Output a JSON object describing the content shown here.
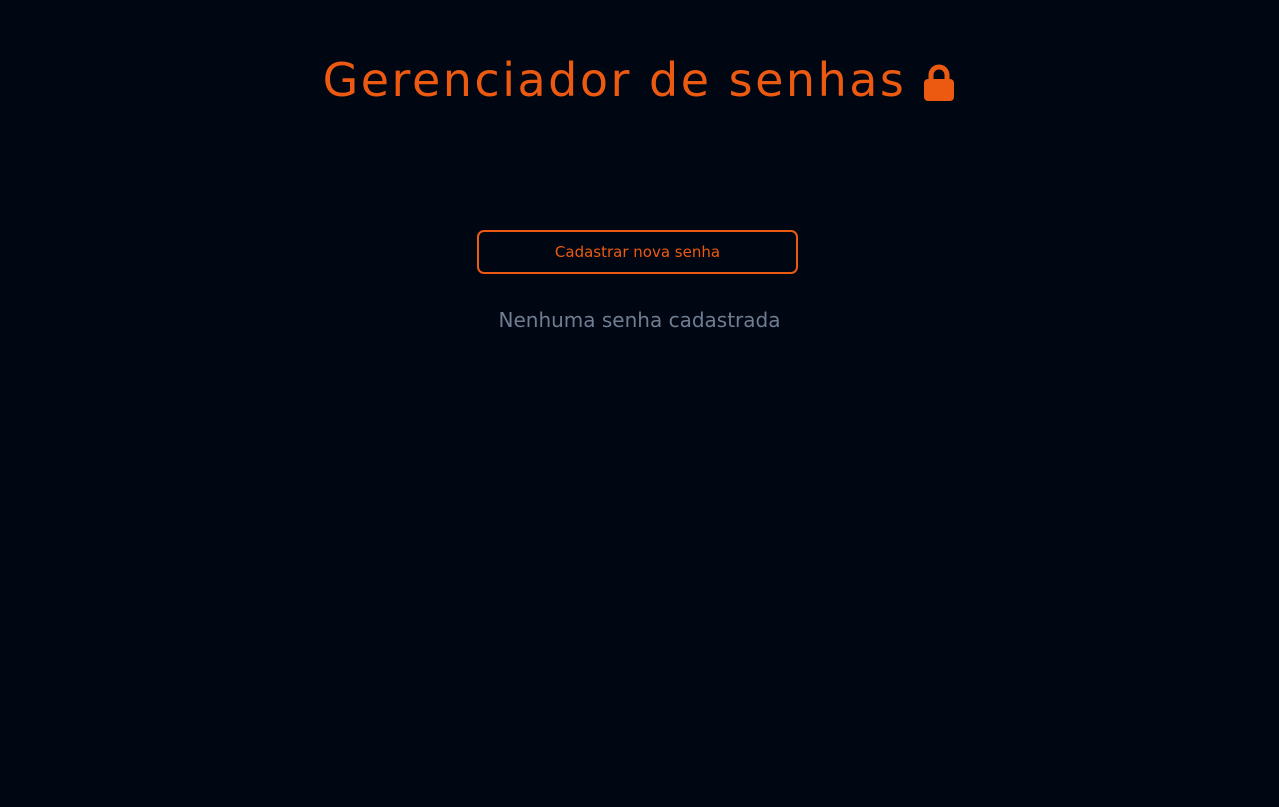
{
  "header": {
    "title": "Gerenciador de senhas",
    "icon": "lock-icon"
  },
  "actions": {
    "register_label": "Cadastrar nova senha"
  },
  "list": {
    "empty_message": "Nenhuma senha cadastrada"
  },
  "colors": {
    "background": "#000612",
    "accent": "#ec5a12",
    "muted_text": "#6f7d91"
  }
}
